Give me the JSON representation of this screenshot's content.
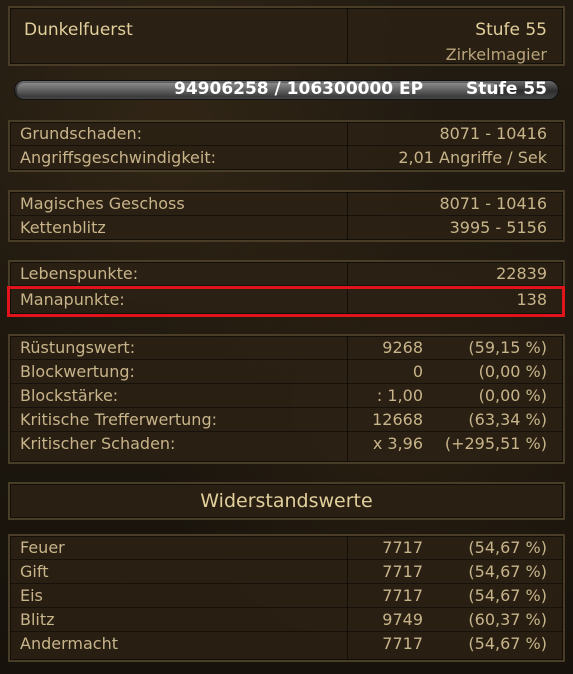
{
  "character": {
    "name": "Dunkelfuerst",
    "level_label": "Stufe 55",
    "class": "Zirkelmagier"
  },
  "experience": {
    "text": "94906258 / 106300000 EP",
    "level": "Stufe 55",
    "progress_fraction": 0.893
  },
  "base_damage": [
    {
      "label": "Grundschaden:",
      "value": "8071 - 10416"
    },
    {
      "label": "Angriffsgeschwindigkeit:",
      "value": "2,01 Angriffe / Sek"
    }
  ],
  "skills": [
    {
      "label": "Magisches Geschoss",
      "value": "8071 - 10416"
    },
    {
      "label": "Kettenblitz",
      "value": "3995 - 5156"
    }
  ],
  "vitals": [
    {
      "label": "Lebenspunkte:",
      "value": "22839"
    },
    {
      "label": "Manapunkte:",
      "value": "138"
    }
  ],
  "defense": [
    {
      "label": "Rüstungswert:",
      "value": "9268",
      "percent": "(59,15 %)"
    },
    {
      "label": "Blockwertung:",
      "value": "0",
      "percent": "(0,00 %)"
    },
    {
      "label": "Blockstärke:",
      "value": ": 1,00",
      "percent": "(0,00 %)"
    },
    {
      "label": "Kritische Trefferwertung:",
      "value": "12668",
      "percent": "(63,34 %)"
    },
    {
      "label": "Kritischer Schaden:",
      "value": "x 3,96",
      "percent": "(+295,51 %)"
    }
  ],
  "resistances": {
    "title": "Widerstandswerte",
    "rows": [
      {
        "label": "Feuer",
        "value": "7717",
        "percent": "(54,67 %)"
      },
      {
        "label": "Gift",
        "value": "7717",
        "percent": "(54,67 %)"
      },
      {
        "label": "Eis",
        "value": "7717",
        "percent": "(54,67 %)"
      },
      {
        "label": "Blitz",
        "value": "9749",
        "percent": "(60,37 %)"
      },
      {
        "label": "Andermacht",
        "value": "7717",
        "percent": "(54,67 %)"
      }
    ]
  },
  "colors": {
    "highlight": "#e0141a",
    "text": "#c8b48a",
    "heading": "#e2cf9c"
  }
}
